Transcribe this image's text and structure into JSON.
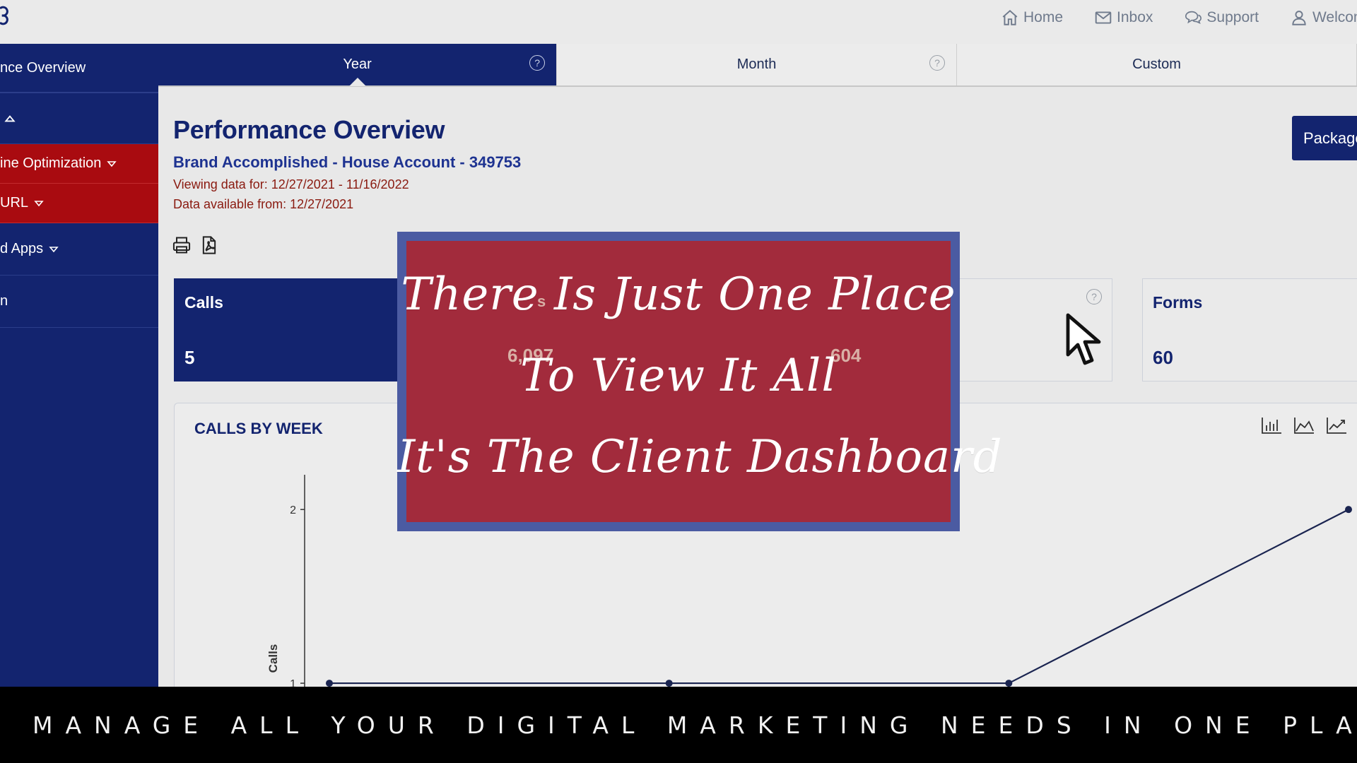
{
  "topnav": {
    "items": [
      {
        "label": "Home",
        "icon": "home-icon"
      },
      {
        "label": "Inbox",
        "icon": "mail-icon"
      },
      {
        "label": "Support",
        "icon": "chat-icon"
      },
      {
        "label": "Welcom",
        "icon": "user-icon"
      }
    ]
  },
  "sidebar": {
    "items": [
      {
        "label": "nce Overview"
      },
      {
        "label": ""
      },
      {
        "label": "ine Optimization"
      },
      {
        "label": "URL"
      },
      {
        "label": "d Apps"
      },
      {
        "label": "n"
      }
    ]
  },
  "tabs": [
    {
      "label": "Year",
      "help": "?"
    },
    {
      "label": "Month",
      "help": "?"
    },
    {
      "label": "Custom"
    }
  ],
  "header": {
    "title": "Performance Overview",
    "account": "Brand Accomplished - House Account - 349753",
    "viewing": "Viewing data for: 12/27/2021 - 11/16/2022",
    "available": "Data available from: 12/27/2021",
    "package_button": "Package"
  },
  "cards": {
    "calls": {
      "label": "Calls",
      "value": "5"
    },
    "views": {
      "value": "6,097",
      "label_fragment": "s"
    },
    "visits": {
      "value": "604"
    },
    "forms": {
      "label": "Forms",
      "value": "60"
    },
    "help": "?"
  },
  "chart_panel": {
    "title": "CALLS BY WEEK"
  },
  "chart_data": {
    "type": "line",
    "title": "CALLS BY WEEK",
    "ylabel": "Calls",
    "xlabel": "",
    "yticks": [
      "1",
      "2"
    ],
    "ylim": [
      0.98,
      2.2
    ],
    "series": [
      {
        "values": [
          1,
          1,
          1,
          2
        ]
      }
    ],
    "line_color": "#1a2450",
    "grid": false
  },
  "banner": {
    "line1": "There Is Just One Place",
    "line2": "To View It All",
    "line3": "It's The Client Dashboard"
  },
  "bottom_strip": {
    "text": "WE MANAGE ALL YOUR DIGITAL MARKETING NEEDS IN ONE PLACE"
  },
  "colors": {
    "primary": "#13246f",
    "accent_red": "#a90b10",
    "banner_red": "#a92834",
    "banner_border": "#4b5ba2"
  }
}
